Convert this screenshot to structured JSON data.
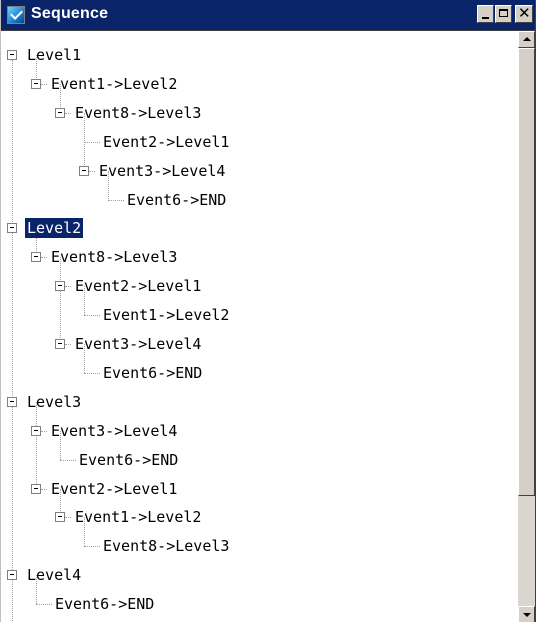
{
  "window": {
    "title": "Sequence",
    "icon": "app-checkmark-icon",
    "controls": [
      "minimize-icon",
      "maximize-icon",
      "close-icon"
    ],
    "title_color": "#0a246a",
    "selection_color": "#0a246a"
  },
  "tree": {
    "nodes": [
      {
        "label": "Level1",
        "depth": 0,
        "expander": "minus",
        "selected": false
      },
      {
        "label": "Event1->Level2",
        "depth": 1,
        "expander": "minus",
        "selected": false
      },
      {
        "label": "Event8->Level3",
        "depth": 2,
        "expander": "minus",
        "selected": false
      },
      {
        "label": "Event2->Level1",
        "depth": 3,
        "expander": "none",
        "selected": false
      },
      {
        "label": "Event3->Level4",
        "depth": 3,
        "expander": "minus",
        "selected": false
      },
      {
        "label": "Event6->END",
        "depth": 4,
        "expander": "none",
        "selected": false
      },
      {
        "label": "Level2",
        "depth": 0,
        "expander": "minus",
        "selected": true
      },
      {
        "label": "Event8->Level3",
        "depth": 1,
        "expander": "minus",
        "selected": false
      },
      {
        "label": "Event2->Level1",
        "depth": 2,
        "expander": "minus",
        "selected": false
      },
      {
        "label": "Event1->Level2",
        "depth": 3,
        "expander": "none",
        "selected": false
      },
      {
        "label": "Event3->Level4",
        "depth": 2,
        "expander": "minus",
        "selected": false
      },
      {
        "label": "Event6->END",
        "depth": 3,
        "expander": "none",
        "selected": false
      },
      {
        "label": "Level3",
        "depth": 0,
        "expander": "minus",
        "selected": false
      },
      {
        "label": "Event3->Level4",
        "depth": 1,
        "expander": "minus",
        "selected": false
      },
      {
        "label": "Event6->END",
        "depth": 2,
        "expander": "none",
        "selected": false
      },
      {
        "label": "Event2->Level1",
        "depth": 1,
        "expander": "minus",
        "selected": false
      },
      {
        "label": "Event1->Level2",
        "depth": 2,
        "expander": "minus",
        "selected": false
      },
      {
        "label": "Event8->Level3",
        "depth": 3,
        "expander": "none",
        "selected": false
      },
      {
        "label": "Level4",
        "depth": 0,
        "expander": "minus",
        "selected": false
      },
      {
        "label": "Event6->END",
        "depth": 1,
        "expander": "none",
        "selected": false
      }
    ]
  },
  "scrollbar": {
    "up_icon": "scroll-up-arrow-icon",
    "down_icon": "scroll-down-arrow-icon"
  }
}
